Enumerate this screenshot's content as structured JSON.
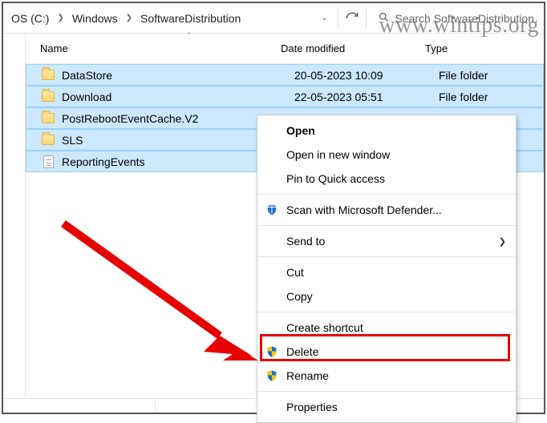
{
  "breadcrumb": {
    "items": [
      "OS (C:)",
      "Windows",
      "SoftwareDistribution"
    ]
  },
  "toolbar": {
    "search_placeholder": "Search SoftwareDistribution"
  },
  "columns": {
    "name": "Name",
    "date": "Date modified",
    "type": "Type"
  },
  "rows": [
    {
      "icon": "folder",
      "name": "DataStore",
      "date": "20-05-2023 10:09",
      "type": "File folder"
    },
    {
      "icon": "folder",
      "name": "Download",
      "date": "22-05-2023 05:51",
      "type": "File folder"
    },
    {
      "icon": "folder",
      "name": "PostRebootEventCache.V2",
      "date": "",
      "type": ""
    },
    {
      "icon": "folder",
      "name": "SLS",
      "date": "",
      "type": ""
    },
    {
      "icon": "file",
      "name": "ReportingEvents",
      "date": "",
      "type": ""
    }
  ],
  "context_menu": {
    "open": "Open",
    "open_new_window": "Open in new window",
    "pin_quick_access": "Pin to Quick access",
    "scan_defender": "Scan with Microsoft Defender...",
    "send_to": "Send to",
    "cut": "Cut",
    "copy": "Copy",
    "create_shortcut": "Create shortcut",
    "delete": "Delete",
    "rename": "Rename",
    "properties": "Properties"
  },
  "watermark": "www.wintips.org"
}
